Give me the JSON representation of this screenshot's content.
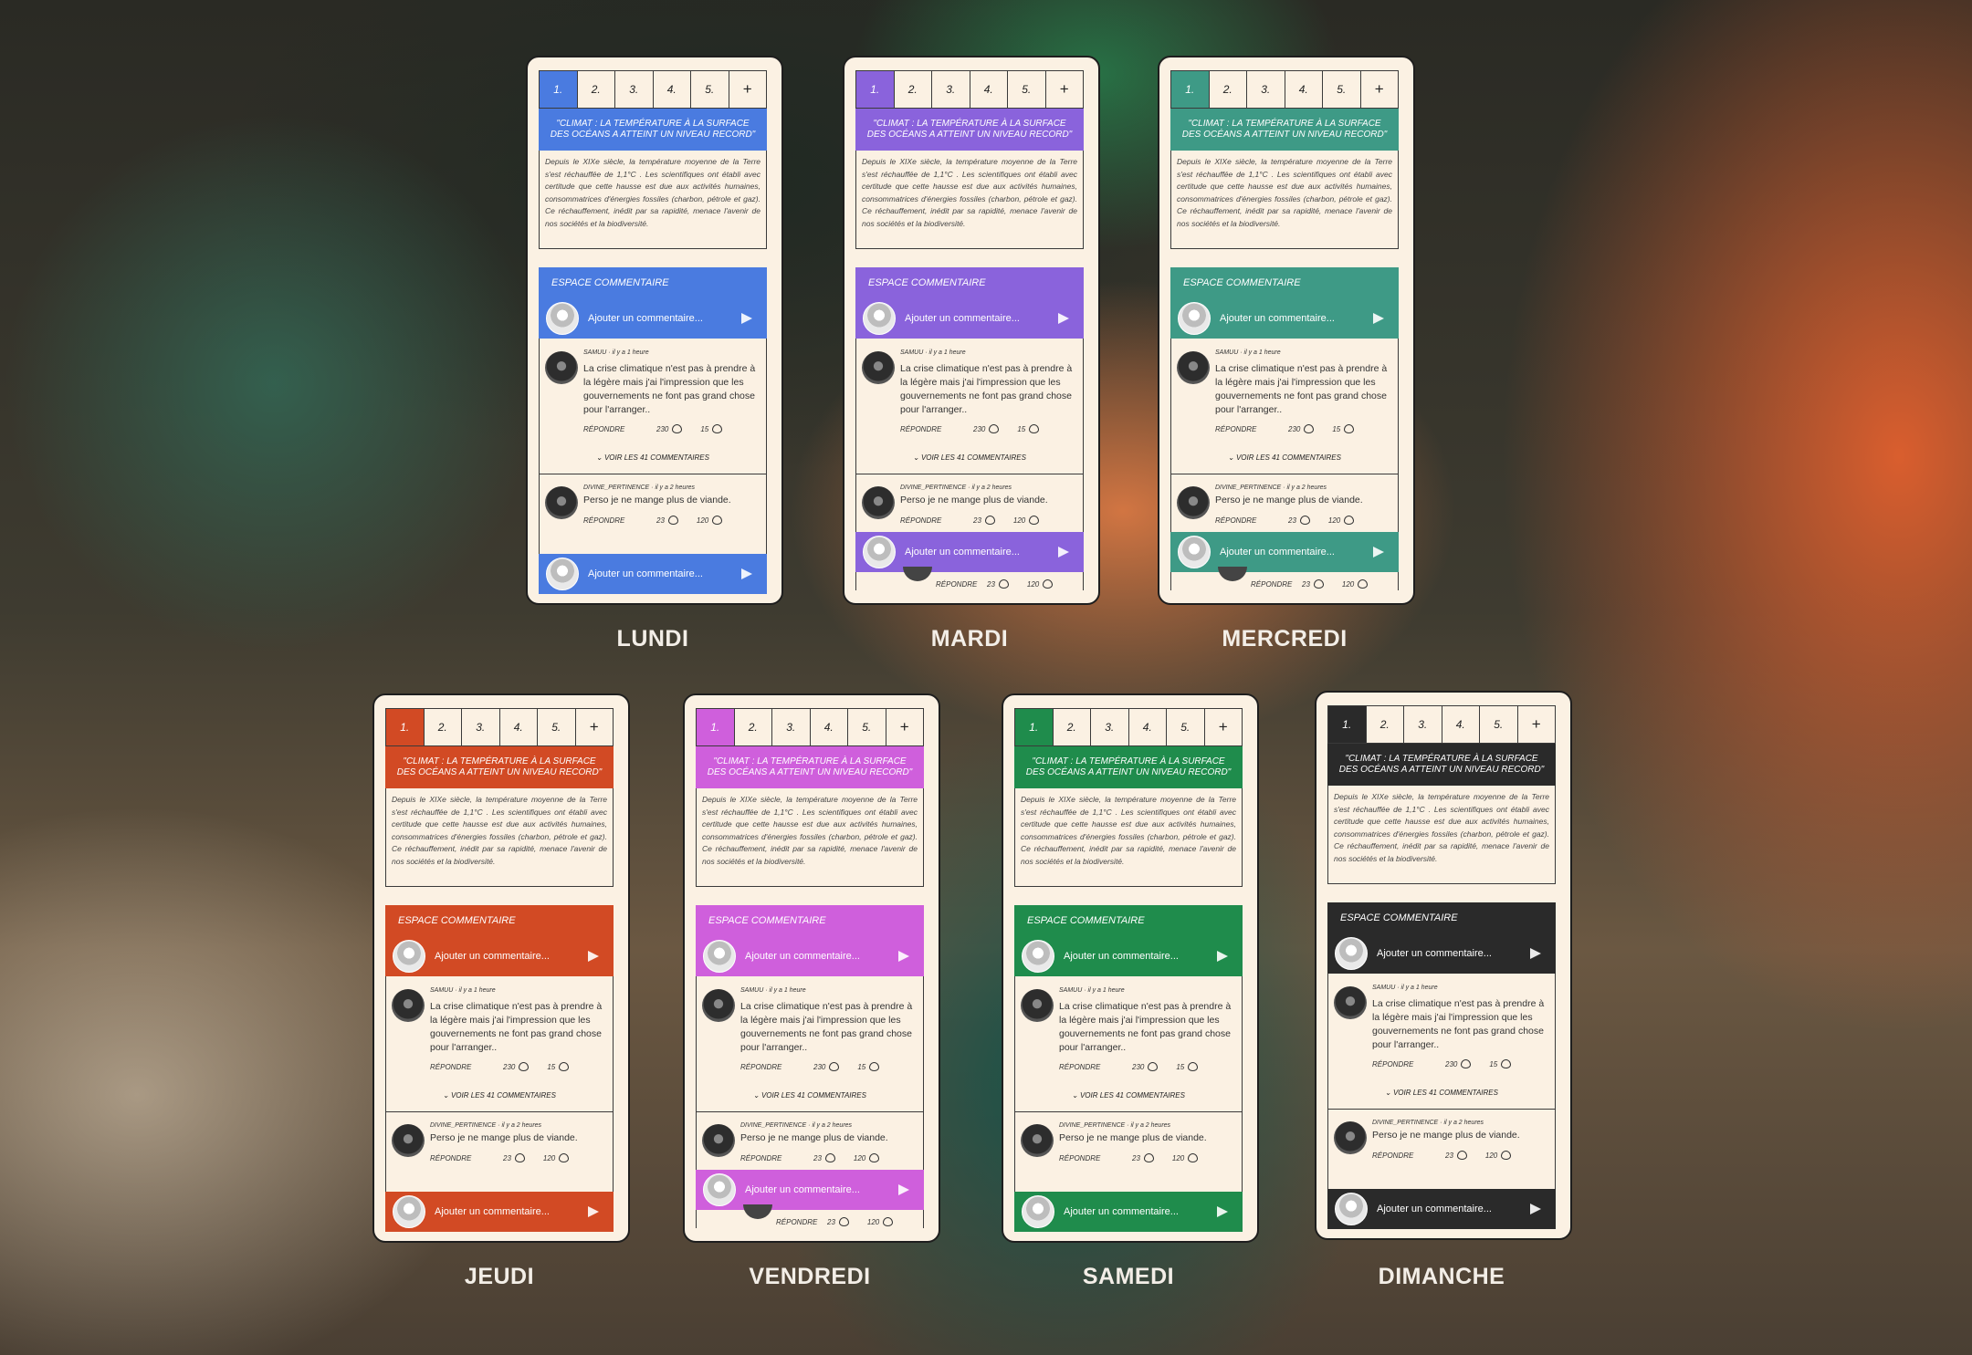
{
  "tabs": [
    "1.",
    "2.",
    "3.",
    "4.",
    "5.",
    "+"
  ],
  "headline": "\"CLIMAT : LA TEMPÉRATURE À LA SURFACE DES OCÉANS A ATTEINT UN NIVEAU RECORD\"",
  "summary": "Depuis le XIXe siècle, la température moyenne de la Terre s'est réchauffée de 1,1°C . Les scientifiques ont établi avec certitude que cette hausse est due aux activités humaines, consommatrices d'énergies fossiles (charbon, pétrole et gaz). Ce réchauffement, inédit par sa rapidité, menace l'avenir de nos sociétés et la biodiversité.",
  "comment_space_title": "ESPACE COMMENTAIRE",
  "comment_placeholder": "Ajouter un commentaire...",
  "comments": [
    {
      "author": "SAMUU",
      "time": "il y a 1 heure",
      "text": "La crise climatique n'est pas à prendre à la légère mais j'ai l'impression que les gouvernements ne font pas grand chose pour l'arranger..",
      "reply": "RÉPONDRE",
      "likes": "230",
      "hearts": "15"
    },
    {
      "author": "DIVINE_PERTINENCE",
      "time": "il y a 2 heures",
      "text": "Perso je ne mange plus de viande.",
      "reply": "RÉPONDRE",
      "likes": "23",
      "hearts": "120"
    }
  ],
  "view_all": "⌄ VOIR LES 41 COMMENTAIRES",
  "days": [
    {
      "name": "LUNDI",
      "color": "#4a7be0"
    },
    {
      "name": "MARDI",
      "color": "#8a63dc"
    },
    {
      "name": "MERCREDI",
      "color": "#3e9a86"
    },
    {
      "name": "JEUDI",
      "color": "#d24a24"
    },
    {
      "name": "VENDREDI",
      "color": "#cf5fdc"
    },
    {
      "name": "SAMEDI",
      "color": "#1f8c4c"
    },
    {
      "name": "DIMANCHE",
      "color": "#2a2a2a"
    }
  ],
  "icons": {
    "send": "send-icon",
    "heart": "heart-icon",
    "like": "like-icon",
    "avatar": "avatar"
  }
}
